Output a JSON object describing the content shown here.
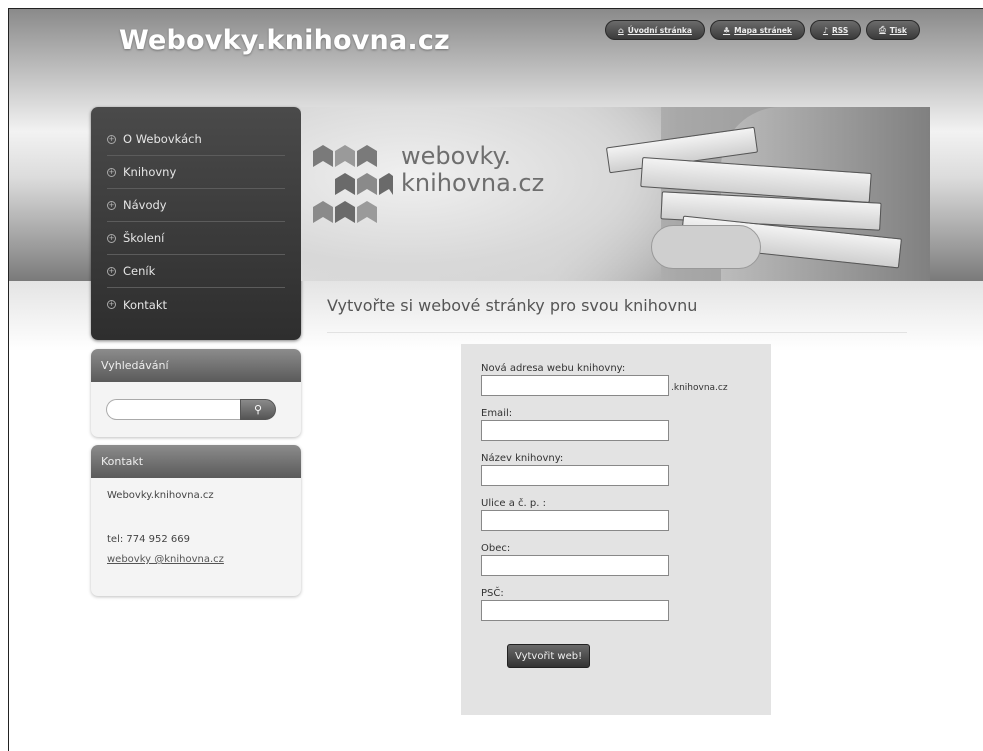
{
  "site": {
    "title": "Webovky.knihovna.cz"
  },
  "top_links": [
    {
      "label": "Úvodní stránka",
      "icon": "home-icon"
    },
    {
      "label": "Mapa stránek",
      "icon": "sitemap-icon"
    },
    {
      "label": "RSS",
      "icon": "rss-icon"
    },
    {
      "label": "Tisk",
      "icon": "print-icon"
    }
  ],
  "nav": {
    "items": [
      {
        "label": "O Webovkách"
      },
      {
        "label": "Knihovny"
      },
      {
        "label": "Návody"
      },
      {
        "label": "Školení"
      },
      {
        "label": "Ceník"
      },
      {
        "label": "Kontakt"
      }
    ]
  },
  "banner": {
    "logo_line1": "webovky.",
    "logo_line2": "knihovna.cz"
  },
  "main": {
    "heading": "Vytvořte si webové stránky pro svou knihovnu"
  },
  "search": {
    "title": "Vyhledávání",
    "button_icon": "search-icon"
  },
  "contact": {
    "title": "Kontakt",
    "name": "Webovky.knihovna.cz",
    "tel": "tel: 774 952 669",
    "email": "webovky @knihovna.cz"
  },
  "form": {
    "fields": [
      {
        "label": "Nová adresa webu knihovny:",
        "value": "",
        "suffix": ".knihovna.cz"
      },
      {
        "label": "Email:",
        "value": ""
      },
      {
        "label": "Název knihovny:",
        "value": ""
      },
      {
        "label": "Ulice a č. p. :",
        "value": ""
      },
      {
        "label": "Obec:",
        "value": ""
      },
      {
        "label": "PSČ:",
        "value": ""
      }
    ],
    "submit_label": "Vytvořit web!"
  },
  "colors": {
    "nav_bg": "#3a3a3a",
    "form_bg": "#e3e3e3",
    "box_head": "#6e6e6e"
  }
}
